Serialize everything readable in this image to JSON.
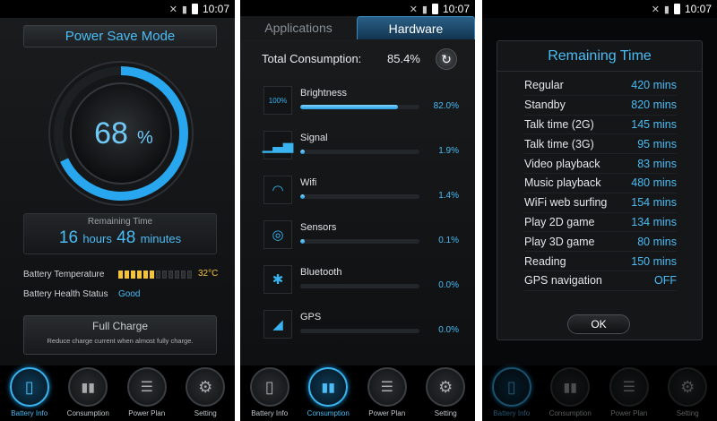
{
  "status_bar": {
    "time": "10:07"
  },
  "panel1": {
    "title": "Power Save Mode",
    "battery_percent_number": "68",
    "battery_percent_symbol": "%",
    "battery_level": 0.68,
    "remaining_label": "Remaining Time",
    "remaining_hours": "16",
    "hours_unit": "hours",
    "remaining_minutes": "48",
    "minutes_unit": "minutes",
    "temp_label": "Battery Temperature",
    "temp_value": "32°C",
    "temp_level_segments": 6,
    "temp_total_segments": 12,
    "health_label": "Battery Health Status",
    "health_value": "Good",
    "full_charge_title": "Full Charge",
    "full_charge_desc": "Reduce charge current when almost fully charge."
  },
  "nav": {
    "items": [
      {
        "label": "Battery Info",
        "icon": "battery-icon"
      },
      {
        "label": "Consumption",
        "icon": "bar-chart-icon"
      },
      {
        "label": "Power Plan",
        "icon": "list-icon"
      },
      {
        "label": "Setting",
        "icon": "gear-icon"
      }
    ]
  },
  "panel2": {
    "tabs": [
      "Applications",
      "Hardware"
    ],
    "total_label": "Total Consumption:",
    "total_value": "85.4%",
    "items": [
      {
        "name": "Brightness",
        "percent": "82.0%",
        "value": 0.82,
        "icon": "brightness-icon",
        "icon_text": "100%"
      },
      {
        "name": "Signal",
        "percent": "1.9%",
        "value": 0.019,
        "icon": "signal-icon"
      },
      {
        "name": "Wifi",
        "percent": "1.4%",
        "value": 0.014,
        "icon": "wifi-icon"
      },
      {
        "name": "Sensors",
        "percent": "0.1%",
        "value": 0.001,
        "icon": "sensor-icon"
      },
      {
        "name": "Bluetooth",
        "percent": "0.0%",
        "value": 0.0,
        "icon": "bluetooth-icon"
      },
      {
        "name": "GPS",
        "percent": "0.0%",
        "value": 0.0,
        "icon": "gps-icon"
      }
    ]
  },
  "panel3": {
    "title": "Remaining Time",
    "rows": [
      {
        "label": "Regular",
        "value": "420 mins"
      },
      {
        "label": "Standby",
        "value": "820 mins"
      },
      {
        "label": "Talk time (2G)",
        "value": "145 mins"
      },
      {
        "label": "Talk time (3G)",
        "value": "95 mins"
      },
      {
        "label": "Video playback",
        "value": "83 mins"
      },
      {
        "label": "Music playback",
        "value": "480 mins"
      },
      {
        "label": "WiFi web surfing",
        "value": "154 mins"
      },
      {
        "label": "Play 2D game",
        "value": "134 mins"
      },
      {
        "label": "Play 3D game",
        "value": "80 mins"
      },
      {
        "label": "Reading",
        "value": "150 mins"
      },
      {
        "label": "GPS navigation",
        "value": "OFF"
      }
    ],
    "ok_label": "OK"
  }
}
